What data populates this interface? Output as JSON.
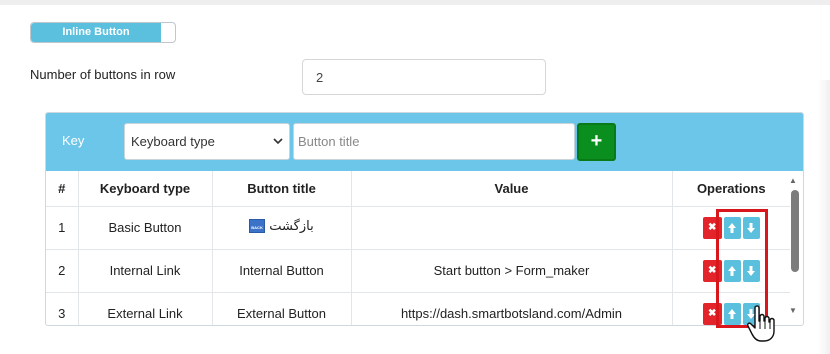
{
  "toggle": {
    "label": "Inline Button"
  },
  "row_count": {
    "label": "Number of buttons in row",
    "value": "2"
  },
  "form": {
    "key_label": "Key",
    "keyboard_type_selected": "Keyboard type",
    "button_title_placeholder": "Button title",
    "add_symbol": "+"
  },
  "table": {
    "headers": [
      "#",
      "Keyboard type",
      "Button title",
      "Value",
      "Operations"
    ],
    "rows": [
      {
        "num": "1",
        "type": "Basic Button",
        "title": "بازگشت",
        "value": ""
      },
      {
        "num": "2",
        "type": "Internal Link",
        "title": "Internal Button",
        "value": "Start button > Form_maker"
      },
      {
        "num": "3",
        "type": "External Link",
        "title": "External Button",
        "value": "https://dash.smartbotsland.com/Admin"
      }
    ]
  },
  "icons": {
    "delete": "✖",
    "up": "arrow-up-icon",
    "down": "arrow-down-icon",
    "back": "back-icon",
    "cursor": "hand-pointer-icon"
  },
  "colors": {
    "accent": "#6cc6ea",
    "toggle": "#5bc0de",
    "add_button": "#0a8f1f",
    "delete_button": "#e3242b",
    "move_button": "#5bc0de",
    "highlight": "#d9161c"
  }
}
